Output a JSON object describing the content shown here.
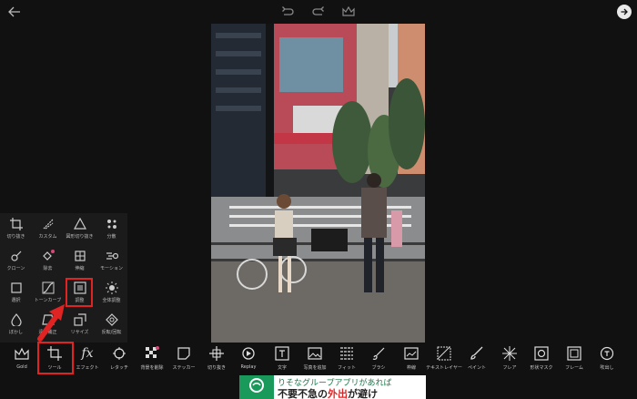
{
  "topbar": {
    "icons": [
      "back-arrow-icon",
      "undo-icon",
      "redo-icon",
      "crown-icon",
      "apply-check-icon"
    ]
  },
  "tool_panel": {
    "items": [
      {
        "label": "切り抜き",
        "icon": "crop-icon"
      },
      {
        "label": "カスタム",
        "icon": "freeform-crop-icon"
      },
      {
        "label": "図形切り抜き",
        "icon": "shape-crop-icon"
      },
      {
        "label": "分散",
        "icon": "dispersion-icon"
      },
      {
        "label": "クローン",
        "icon": "clone-icon"
      },
      {
        "label": "除去",
        "icon": "remove-icon"
      },
      {
        "label": "伸縮",
        "icon": "stretch-icon"
      },
      {
        "label": "モーション",
        "icon": "motion-icon"
      },
      {
        "label": "選択",
        "icon": "select-icon"
      },
      {
        "label": "トーンカーブ",
        "icon": "tone-curve-icon"
      },
      {
        "label": "調整",
        "icon": "adjust-icon"
      },
      {
        "label": "全体調整",
        "icon": "enhance-icon"
      },
      {
        "label": "ぼかし",
        "icon": "blur-drop-icon"
      },
      {
        "label": "遠近補正",
        "icon": "perspective-icon"
      },
      {
        "label": "リサイズ",
        "icon": "resize-icon"
      },
      {
        "label": "反転/回転",
        "icon": "flip-rotate-icon"
      }
    ]
  },
  "toolbar": {
    "items": [
      {
        "label": "Gold",
        "icon": "crown-icon"
      },
      {
        "label": "ツール",
        "icon": "tools-crop-icon"
      },
      {
        "label": "エフェクト",
        "icon": "fx-icon"
      },
      {
        "label": "レタッチ",
        "icon": "retouch-icon"
      },
      {
        "label": "背景を削除",
        "icon": "remove-background-icon"
      },
      {
        "label": "ステッカー",
        "icon": "sticker-icon"
      },
      {
        "label": "切り抜き",
        "icon": "cutout-icon"
      },
      {
        "label": "Replay",
        "icon": "replay-icon"
      },
      {
        "label": "文字",
        "icon": "text-icon"
      },
      {
        "label": "写真を追加",
        "icon": "add-photo-icon"
      },
      {
        "label": "フィット",
        "icon": "fit-icon"
      },
      {
        "label": "ブラシ",
        "icon": "brush-icon"
      },
      {
        "label": "枠線",
        "icon": "border-icon"
      },
      {
        "label": "テキストレイヤー",
        "icon": "text-layer-icon"
      },
      {
        "label": "ペイント",
        "icon": "paint-icon"
      },
      {
        "label": "フレア",
        "icon": "lens-flare-icon"
      },
      {
        "label": "形状マスク",
        "icon": "shape-mask-icon"
      },
      {
        "label": "フレーム",
        "icon": "frame-icon"
      },
      {
        "label": "吹出し",
        "icon": "callout-icon"
      }
    ]
  },
  "ad": {
    "line1": "りそなグループアプリがあれば",
    "line2_pre": "不要不急の",
    "line2_hot": "外出",
    "line2_post": "が避け"
  },
  "colors": {
    "highlight": "#e02424",
    "ad_green": "#1a9a5a"
  }
}
